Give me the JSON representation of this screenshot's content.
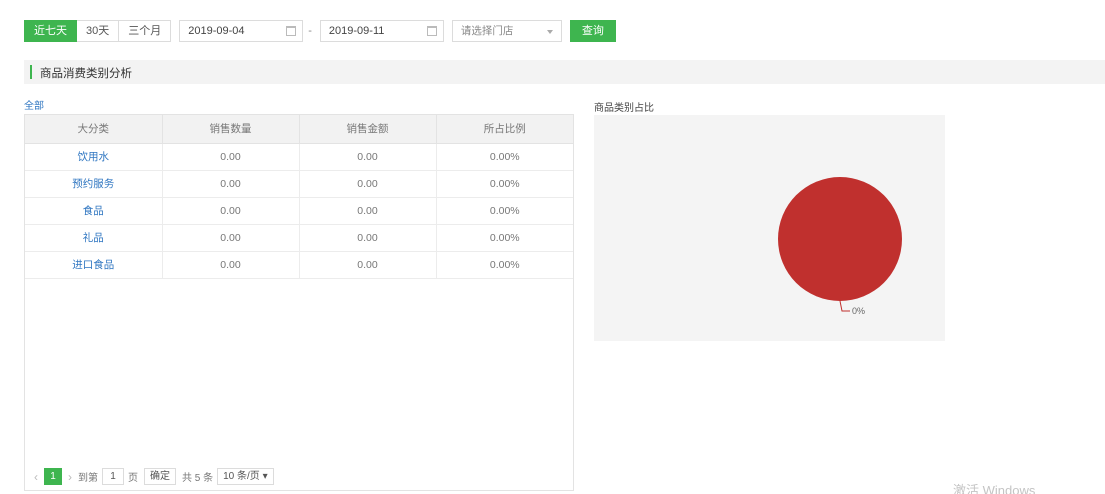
{
  "filters": {
    "ranges": [
      "近七天",
      "30天",
      "三个月"
    ],
    "active_range": 0,
    "start_date": "2019-09-04",
    "separator": "-",
    "end_date": "2019-09-11",
    "store_placeholder": "请选择门店",
    "query_label": "查询"
  },
  "section": {
    "title": "商品消费类别分析"
  },
  "table": {
    "all_link": "全部",
    "headers": [
      "大分类",
      "销售数量",
      "销售金额",
      "所占比例"
    ],
    "rows": [
      [
        "饮用水",
        "0.00",
        "0.00",
        "0.00%"
      ],
      [
        "预约服务",
        "0.00",
        "0.00",
        "0.00%"
      ],
      [
        "食品",
        "0.00",
        "0.00",
        "0.00%"
      ],
      [
        "礼品",
        "0.00",
        "0.00",
        "0.00%"
      ],
      [
        "进口食品",
        "0.00",
        "0.00",
        "0.00%"
      ]
    ]
  },
  "pager": {
    "prev": "‹",
    "current_page": "1",
    "next": "›",
    "goto_label": "到第",
    "goto_value": "1",
    "page_unit": "页",
    "confirm_label": "确定",
    "total_label": "共 5 条",
    "per_page_label": "10 条/页 ▾"
  },
  "chart_data": {
    "type": "pie",
    "title": "商品类别占比",
    "slices": [
      {
        "label": "0%",
        "value": 100,
        "color": "#c0302e"
      }
    ]
  },
  "watermark": "激活 Windows",
  "colors": {
    "accent": "#3eb54f",
    "link": "#2f76c1",
    "pie": "#c0302e"
  }
}
